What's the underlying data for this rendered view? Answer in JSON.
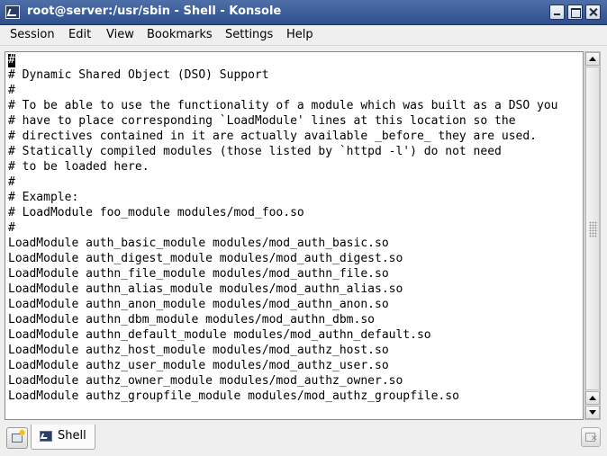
{
  "window": {
    "title": "root@server:/usr/sbin - Shell - Konsole",
    "app_icon": "konsole-terminal-icon",
    "controls": [
      "minimize-icon",
      "maximize-icon",
      "close-icon"
    ]
  },
  "menubar": {
    "items": [
      "Session",
      "Edit",
      "View",
      "Bookmarks",
      "Settings",
      "Help"
    ]
  },
  "terminal": {
    "cursor_char": "#",
    "lines": [
      "",
      "# Dynamic Shared Object (DSO) Support",
      "#",
      "# To be able to use the functionality of a module which was built as a DSO you",
      "# have to place corresponding `LoadModule' lines at this location so the",
      "# directives contained in it are actually available _before_ they are used.",
      "# Statically compiled modules (those listed by `httpd -l') do not need",
      "# to be loaded here.",
      "#",
      "# Example:",
      "# LoadModule foo_module modules/mod_foo.so",
      "#",
      "LoadModule auth_basic_module modules/mod_auth_basic.so",
      "LoadModule auth_digest_module modules/mod_auth_digest.so",
      "LoadModule authn_file_module modules/mod_authn_file.so",
      "LoadModule authn_alias_module modules/mod_authn_alias.so",
      "LoadModule authn_anon_module modules/mod_authn_anon.so",
      "LoadModule authn_dbm_module modules/mod_authn_dbm.so",
      "LoadModule authn_default_module modules/mod_authn_default.so",
      "LoadModule authz_host_module modules/mod_authz_host.so",
      "LoadModule authz_user_module modules/mod_authz_user.so",
      "LoadModule authz_owner_module modules/mod_authz_owner.so",
      "LoadModule authz_groupfile_module modules/mod_authz_groupfile.so"
    ]
  },
  "tabbar": {
    "new_tab_icon": "new-session-icon",
    "tabs": [
      {
        "label": "Shell",
        "icon": "terminal-icon"
      }
    ],
    "close_tab_icon": "close-session-icon"
  },
  "colors": {
    "titlebar": "#3d5e9c",
    "chrome": "#efefef",
    "terminal_bg": "#ffffff",
    "terminal_fg": "#000000"
  }
}
